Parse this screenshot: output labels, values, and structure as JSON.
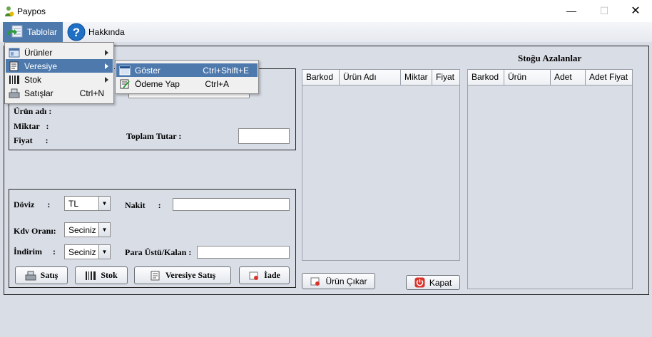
{
  "window": {
    "title": "Paypos",
    "minimize": "—",
    "maximize": "☐",
    "close": "✕"
  },
  "menubar": {
    "tablolar": "Tablolar",
    "hakkinda": "Hakkında"
  },
  "tablolar_menu": {
    "items": [
      {
        "label": "Ürünler",
        "icon": "products-icon",
        "submenu": true
      },
      {
        "label": "Veresiye",
        "icon": "ledger-icon",
        "submenu": true
      },
      {
        "label": "Stok",
        "icon": "stock-icon",
        "submenu": true
      },
      {
        "label": "Satışlar",
        "icon": "sales-icon",
        "accelerator": "Ctrl+N"
      }
    ]
  },
  "veresiye_menu": {
    "items": [
      {
        "label": "Göster",
        "accelerator": "Ctrl+Shift+E",
        "icon": "window-icon"
      },
      {
        "label": "Ödeme Yap",
        "accelerator": "Ctrl+A",
        "icon": "payment-icon"
      }
    ]
  },
  "product_panel": {
    "urun_adi": "Ürün adı :",
    "miktar": "Miktar   :",
    "fiyat": "Fiyat      :",
    "toplam_tutar": "Toplam Tutar :"
  },
  "payment_panel": {
    "doviz_label": "Döviz      :",
    "doviz_value": "TL",
    "nakit_label": "Nakit      :",
    "kdv_label": "Kdv Oranı:",
    "kdv_value": "Seciniz",
    "indirim_label": "İndirim     :",
    "indirim_value": "Seciniz",
    "para_ustu_label": "Para Üstü/Kalan :"
  },
  "buttons": {
    "satis": "Satış",
    "stok": "Stok",
    "veresiye_satis": "Veresiye Satış",
    "iade": "İade",
    "urun_cikar": "Ürün Çıkar",
    "kapat": "Kapat"
  },
  "cart_table": {
    "columns": [
      "Barkod",
      "Ürün Adı",
      "Miktar",
      "Fiyat"
    ],
    "rows": []
  },
  "low_stock": {
    "title": "Stoğu Azalanlar",
    "columns": [
      "Barkod",
      "Ürün",
      "Adet",
      "Adet Fiyat"
    ],
    "rows": []
  },
  "colors": {
    "accent": "#4d79ad",
    "background": "#d9dde6",
    "close_red": "#d9342b"
  }
}
